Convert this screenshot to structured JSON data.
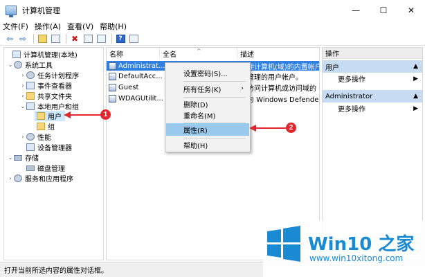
{
  "window": {
    "title": "计算机管理",
    "minimize_glyph": "—",
    "maximize_glyph": "☐",
    "close_glyph": "✕"
  },
  "menu": [
    "文件(F)",
    "操作(A)",
    "查看(V)",
    "帮助(H)"
  ],
  "toolbar": {
    "icons": [
      "back-arrow-icon",
      "forward-arrow-icon",
      "up-folder-icon",
      "show-tree-icon",
      "delete-icon",
      "properties-icon",
      "export-icon",
      "help-icon",
      "show-action-pane-icon"
    ],
    "back_glyph": "⇦",
    "forward_glyph": "⇨",
    "delete_glyph": "✖",
    "help_glyph": "?"
  },
  "tree": {
    "items": [
      {
        "label": "计算机管理(本地)",
        "icon": "computer-management-icon"
      },
      {
        "label": "系统工具",
        "icon": "tools-icon"
      },
      {
        "label": "任务计划程序",
        "icon": "clock-icon"
      },
      {
        "label": "事件查看器",
        "icon": "event-viewer-icon"
      },
      {
        "label": "共享文件夹",
        "icon": "shared-folder-icon"
      },
      {
        "label": "本地用户和组",
        "icon": "users-icon"
      },
      {
        "label": "用户",
        "icon": "folder-icon"
      },
      {
        "label": "组",
        "icon": "folder-icon"
      },
      {
        "label": "性能",
        "icon": "performance-icon"
      },
      {
        "label": "设备管理器",
        "icon": "device-manager-icon"
      },
      {
        "label": "存储",
        "icon": "storage-icon"
      },
      {
        "label": "磁盘管理",
        "icon": "disk-icon"
      },
      {
        "label": "服务和应用程序",
        "icon": "services-icon"
      }
    ],
    "expand_glyph": "⌄",
    "collapse_glyph": "›"
  },
  "list": {
    "columns": [
      "名称",
      "全名",
      "描述"
    ],
    "rows": [
      {
        "name": "Administrat...",
        "fullname": "",
        "desc": "管理计算机(域)的内置帐户"
      },
      {
        "name": "DefaultAcc...",
        "fullname": "",
        "desc": "统管理的用户帐户。"
      },
      {
        "name": "Guest",
        "fullname": "",
        "desc": "宾访问计算机或访问域的"
      },
      {
        "name": "WDAGUtilit...",
        "fullname": "",
        "desc": "统为 Windows Defender"
      }
    ],
    "sort_glyph": "^"
  },
  "actions": {
    "title": "操作",
    "sections": [
      {
        "label": "用户",
        "item": "更多操作"
      },
      {
        "label": "Administrator",
        "item": "更多操作"
      }
    ],
    "chevron_up": "▲",
    "chevron_right": "▶"
  },
  "context_menu": {
    "items": [
      "设置密码(S)...",
      "所有任务(K)",
      "删除(D)",
      "重命名(M)",
      "属性(R)",
      "帮助(H)"
    ],
    "submenu_glyph": "›",
    "highlighted": "属性(R)"
  },
  "status_bar": "打开当前所选内容的属性对话框。",
  "annotations": {
    "badge1": "1",
    "badge2": "2",
    "color": "#e2262b"
  },
  "watermark": {
    "brand": "Win10 之家",
    "url": "www.win10xitong.com",
    "color": "#1a8ad3"
  }
}
